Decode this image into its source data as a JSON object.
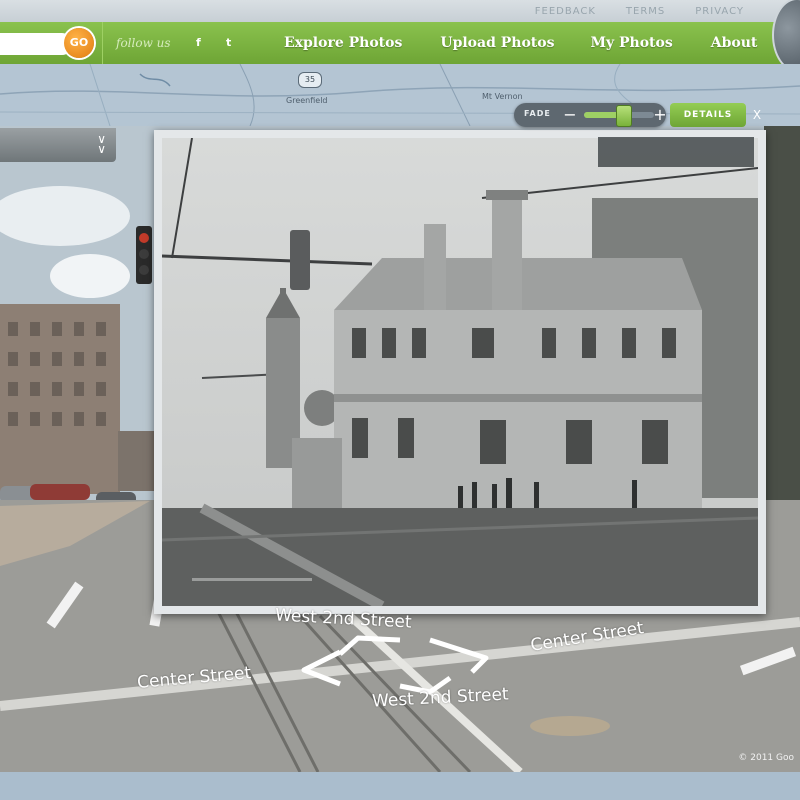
{
  "topbar": {
    "links": [
      "FEEDBACK",
      "TERMS",
      "PRIVACY"
    ]
  },
  "nav": {
    "go_label": "GO",
    "follow_label": "follow us",
    "social": [
      "f",
      "t"
    ],
    "items": [
      "Explore Photos",
      "Upload Photos",
      "My Photos",
      "About"
    ]
  },
  "map": {
    "labels": [
      "Greenfield",
      "Mt Vernon"
    ],
    "highway": "35"
  },
  "fade_control": {
    "label": "FADE",
    "level": 0.55
  },
  "details_label": "DETAILS",
  "close_label": "X",
  "street_labels": {
    "west_2nd_top": "West 2nd Street",
    "west_2nd_bottom": "West 2nd Street",
    "center_left": "Center Street",
    "center_right": "Center Street"
  },
  "copyright": "© 2011 Goo",
  "colors": {
    "brand_green": "#7ab43f",
    "accent_orange": "#f29a1e"
  }
}
